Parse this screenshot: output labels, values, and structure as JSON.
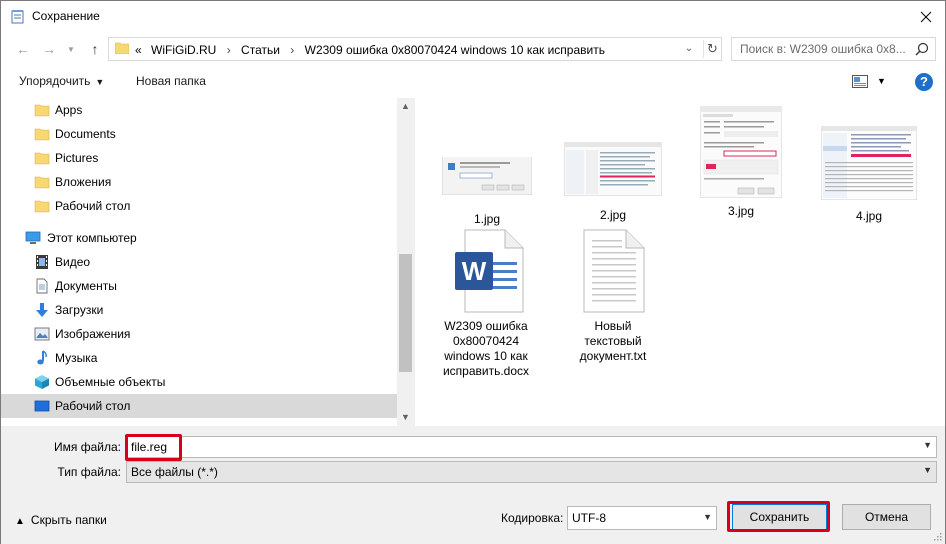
{
  "window": {
    "title": "Сохранение"
  },
  "address": {
    "overflow": "«",
    "crumbs": [
      "WiFiGiD.RU",
      "Статьи",
      "W2309 ошибка 0x80070424 windows 10 как исправить"
    ],
    "search_placeholder": "Поиск в: W2309 ошибка 0x8..."
  },
  "toolbar": {
    "organize_label": "Упорядочить",
    "new_folder_label": "Новая папка",
    "help_label": "?"
  },
  "nav": {
    "items": [
      {
        "label": "Apps",
        "icon": "folder-icon"
      },
      {
        "label": "Documents",
        "icon": "folder-icon"
      },
      {
        "label": "Pictures",
        "icon": "folder-icon"
      },
      {
        "label": "Вложения",
        "icon": "folder-icon"
      },
      {
        "label": "Рабочий стол",
        "icon": "folder-icon"
      },
      {
        "label": "Этот компьютер",
        "icon": "computer-icon"
      },
      {
        "label": "Видео",
        "icon": "video-icon"
      },
      {
        "label": "Документы",
        "icon": "documents-icon"
      },
      {
        "label": "Загрузки",
        "icon": "downloads-icon"
      },
      {
        "label": "Изображения",
        "icon": "pictures-icon"
      },
      {
        "label": "Музыка",
        "icon": "music-icon"
      },
      {
        "label": "Объемные объекты",
        "icon": "3d-objects-icon"
      },
      {
        "label": "Рабочий стол",
        "icon": "desktop-icon"
      }
    ],
    "selected_index": 12
  },
  "files": [
    {
      "name": "1.jpg",
      "type": "image"
    },
    {
      "name": "2.jpg",
      "type": "image"
    },
    {
      "name": "3.jpg",
      "type": "image"
    },
    {
      "name": "4.jpg",
      "type": "image"
    },
    {
      "name": "W2309 ошибка 0x80070424 windows 10 как исправить.docx",
      "type": "word"
    },
    {
      "name": "Новый текстовый документ.txt",
      "type": "text"
    }
  ],
  "bottom": {
    "filename_label": "Имя файла:",
    "filename_value": "file.reg",
    "filetype_label": "Тип файла:",
    "filetype_value": "Все файлы  (*.*)",
    "hide_folders_label": "Скрыть папки",
    "encoding_label": "Кодировка:",
    "encoding_value": "UTF-8",
    "save_label": "Сохранить",
    "cancel_label": "Отмена"
  },
  "colors": {
    "highlight_red": "#d6001c",
    "selection_gray": "#d9d9d9",
    "folder_yellow": "#f8d775",
    "accent_blue": "#0078d7",
    "word_blue": "#2b579a"
  }
}
